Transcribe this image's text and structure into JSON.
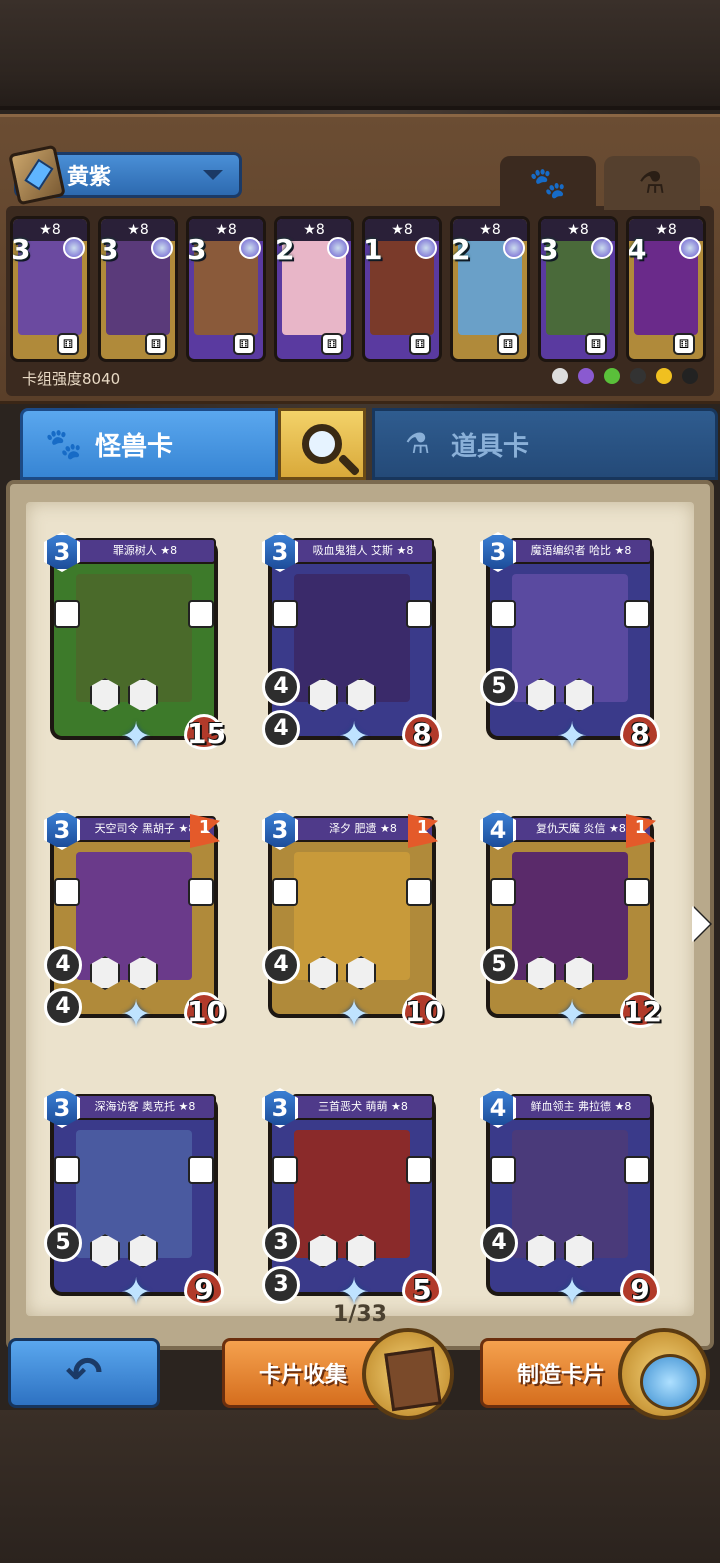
{
  "deck": {
    "name": "黄紫",
    "strength_label": "卡组强度8040"
  },
  "deck_tabs": {
    "monster_icon": "paw-icon",
    "item_icon": "potion-icon"
  },
  "mini_cards": [
    {
      "cost": "3",
      "stars": "★8",
      "color": "gold",
      "art": "#6b4aa0"
    },
    {
      "cost": "3",
      "stars": "★8",
      "color": "gold",
      "art": "#5a3a7a"
    },
    {
      "cost": "3",
      "stars": "★8",
      "color": "purple",
      "art": "#8a5a3a"
    },
    {
      "cost": "2",
      "stars": "★8",
      "color": "purple",
      "art": "#e8b6c8"
    },
    {
      "cost": "1",
      "stars": "★8",
      "color": "purple",
      "art": "#7a3a2a"
    },
    {
      "cost": "2",
      "stars": "★8",
      "color": "gold",
      "art": "#6aa0c8"
    },
    {
      "cost": "3",
      "stars": "★8",
      "color": "purple",
      "art": "#4a6a3a"
    },
    {
      "cost": "4",
      "stars": "★8",
      "color": "gold",
      "art": "#6a2a8a"
    }
  ],
  "type_tabs": {
    "monster_label": "怪兽卡",
    "item_label": "道具卡"
  },
  "cards": [
    {
      "name": "罪源树人 ★8",
      "cost": "3",
      "hp": "15",
      "atk1": "",
      "atk2": "",
      "frame": "#3d7a2a",
      "art": "#4a6a2a",
      "flag": ""
    },
    {
      "name": "吸血鬼猎人 艾斯 ★8",
      "cost": "3",
      "hp": "8",
      "atk1": "4",
      "atk2": "4",
      "frame": "#3a3a8a",
      "art": "#3a2a6a",
      "flag": ""
    },
    {
      "name": "魔语编织者 哈比 ★8",
      "cost": "3",
      "hp": "8",
      "atk1": "5",
      "atk2": "",
      "frame": "#3a3a8a",
      "art": "#5a4aa0",
      "flag": ""
    },
    {
      "name": "天空司令 黑胡子 ★8",
      "cost": "3",
      "hp": "10",
      "atk1": "4",
      "atk2": "4",
      "frame": "#b08a3a",
      "art": "#6a3a8a",
      "flag": "1"
    },
    {
      "name": "泽夕 肥遗 ★8",
      "cost": "3",
      "hp": "10",
      "atk1": "4",
      "atk2": "",
      "frame": "#b08a3a",
      "art": "#c89a3a",
      "flag": "1"
    },
    {
      "name": "复仇天魔 炎信 ★8",
      "cost": "4",
      "hp": "12",
      "atk1": "5",
      "atk2": "",
      "frame": "#b08a3a",
      "art": "#5a2a6a",
      "flag": "1"
    },
    {
      "name": "深海访客 奥克托 ★8",
      "cost": "3",
      "hp": "9",
      "atk1": "5",
      "atk2": "",
      "frame": "#3a3a8a",
      "art": "#4a5aa0",
      "flag": ""
    },
    {
      "name": "三首恶犬 萌萌 ★8",
      "cost": "3",
      "hp": "5",
      "atk1": "3",
      "atk2": "3",
      "frame": "#3a3a8a",
      "art": "#8a2a2a",
      "flag": ""
    },
    {
      "name": "鲜血领主 弗拉德 ★8",
      "cost": "4",
      "hp": "9",
      "atk1": "4",
      "atk2": "",
      "frame": "#3a3a8a",
      "art": "#4a3a7a",
      "flag": ""
    }
  ],
  "pagination": {
    "label": "1/33"
  },
  "buttons": {
    "back_glyph": "↶",
    "collect_label": "卡片收集",
    "craft_label": "制造卡片"
  }
}
